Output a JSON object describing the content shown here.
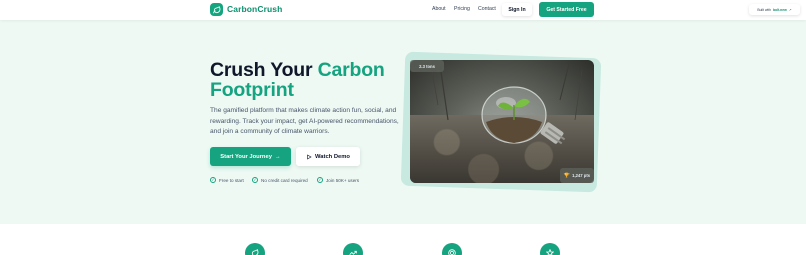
{
  "brand": {
    "name": "CarbonCrush",
    "accent": "#16a37f"
  },
  "nav": {
    "links": [
      "About",
      "Pricing",
      "Contact"
    ],
    "signin_label": "Sign In",
    "cta_label": "Get Started Free"
  },
  "builtwith": {
    "prefix": "Built with",
    "name": "bolt.new"
  },
  "hero": {
    "title_plain": "Crush Your ",
    "title_accent": "Carbon Footprint",
    "description": "The gamified platform that makes climate action fun, social, and rewarding. Track your impact, get AI-powered recommendations, and join a community of climate warriors.",
    "primary_label": "Start Your Journey",
    "secondary_label": "Watch Demo",
    "features": [
      "Free to start",
      "No credit card required",
      "Join 50K+ users"
    ]
  },
  "image_card": {
    "top_badge": "2.3 tons",
    "bottom_badge": "1,247 pts"
  },
  "feature_icons": [
    "leaf-icon",
    "trending-up-icon",
    "target-icon",
    "trophy-icon"
  ]
}
